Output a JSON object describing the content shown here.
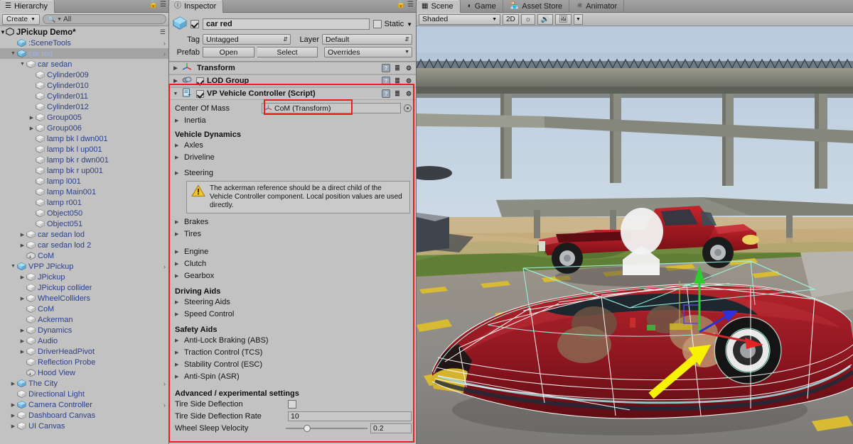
{
  "hierarchy": {
    "tab_label": "Hierarchy",
    "tab_icon": "hierarchy-icon",
    "create_label": "Create",
    "search_placeholder": "All",
    "search_value": "All",
    "scene_name": "JPickup Demo*",
    "items": [
      {
        "label": ":SceneTools",
        "depth": 1,
        "twisty": "",
        "icon": "prefab-cube",
        "chevron": true,
        "selected": false
      },
      {
        "label": "car red",
        "depth": 1,
        "twisty": "down",
        "icon": "prefab-cube",
        "chevron": true,
        "selected": true
      },
      {
        "label": "car sedan",
        "depth": 2,
        "twisty": "down",
        "icon": "gameobject-cube",
        "chevron": false,
        "selected": false
      },
      {
        "label": "Cylinder009",
        "depth": 3,
        "twisty": "",
        "icon": "gameobject-cube",
        "chevron": false,
        "selected": false
      },
      {
        "label": "Cylinder010",
        "depth": 3,
        "twisty": "",
        "icon": "gameobject-cube",
        "chevron": false,
        "selected": false
      },
      {
        "label": "Cylinder011",
        "depth": 3,
        "twisty": "",
        "icon": "gameobject-cube",
        "chevron": false,
        "selected": false
      },
      {
        "label": "Cylinder012",
        "depth": 3,
        "twisty": "",
        "icon": "gameobject-cube",
        "chevron": false,
        "selected": false
      },
      {
        "label": "Group005",
        "depth": 3,
        "twisty": "right",
        "icon": "gameobject-cube",
        "chevron": false,
        "selected": false
      },
      {
        "label": "Group006",
        "depth": 3,
        "twisty": "right",
        "icon": "gameobject-cube",
        "chevron": false,
        "selected": false
      },
      {
        "label": "lamp bk l dwn001",
        "depth": 3,
        "twisty": "",
        "icon": "gameobject-cube",
        "chevron": false,
        "selected": false
      },
      {
        "label": "lamp bk l up001",
        "depth": 3,
        "twisty": "",
        "icon": "gameobject-cube",
        "chevron": false,
        "selected": false
      },
      {
        "label": "lamp bk r dwn001",
        "depth": 3,
        "twisty": "",
        "icon": "gameobject-cube",
        "chevron": false,
        "selected": false
      },
      {
        "label": "lamp bk r up001",
        "depth": 3,
        "twisty": "",
        "icon": "gameobject-cube",
        "chevron": false,
        "selected": false
      },
      {
        "label": "lamp l001",
        "depth": 3,
        "twisty": "",
        "icon": "gameobject-cube",
        "chevron": false,
        "selected": false
      },
      {
        "label": "lamp Main001",
        "depth": 3,
        "twisty": "",
        "icon": "gameobject-cube",
        "chevron": false,
        "selected": false
      },
      {
        "label": "lamp r001",
        "depth": 3,
        "twisty": "",
        "icon": "gameobject-cube",
        "chevron": false,
        "selected": false
      },
      {
        "label": "Object050",
        "depth": 3,
        "twisty": "",
        "icon": "gameobject-cube",
        "chevron": false,
        "selected": false
      },
      {
        "label": "Object051",
        "depth": 3,
        "twisty": "",
        "icon": "gameobject-cube",
        "chevron": false,
        "selected": false
      },
      {
        "label": "car sedan lod",
        "depth": 2,
        "twisty": "right",
        "icon": "gameobject-cube",
        "chevron": false,
        "selected": false
      },
      {
        "label": "car sedan lod 2",
        "depth": 2,
        "twisty": "right",
        "icon": "gameobject-cube",
        "chevron": false,
        "selected": false
      },
      {
        "label": "CoM",
        "depth": 2,
        "twisty": "",
        "icon": "transform-cube",
        "chevron": false,
        "selected": false
      },
      {
        "label": "VPP JPickup",
        "depth": 1,
        "twisty": "down",
        "icon": "prefab-cube",
        "chevron": true,
        "selected": false
      },
      {
        "label": "JPickup",
        "depth": 2,
        "twisty": "right",
        "icon": "gameobject-cube",
        "chevron": false,
        "selected": false
      },
      {
        "label": "JPickup collider",
        "depth": 2,
        "twisty": "",
        "icon": "gameobject-cube",
        "chevron": false,
        "selected": false
      },
      {
        "label": "WheelColliders",
        "depth": 2,
        "twisty": "right",
        "icon": "gameobject-cube",
        "chevron": false,
        "selected": false
      },
      {
        "label": "CoM",
        "depth": 2,
        "twisty": "",
        "icon": "gameobject-cube",
        "chevron": false,
        "selected": false
      },
      {
        "label": "Ackerman",
        "depth": 2,
        "twisty": "",
        "icon": "gameobject-cube",
        "chevron": false,
        "selected": false
      },
      {
        "label": "Dynamics",
        "depth": 2,
        "twisty": "right",
        "icon": "gameobject-cube",
        "chevron": false,
        "selected": false
      },
      {
        "label": "Audio",
        "depth": 2,
        "twisty": "right",
        "icon": "gameobject-cube",
        "chevron": false,
        "selected": false
      },
      {
        "label": "DriverHeadPivot",
        "depth": 2,
        "twisty": "right",
        "icon": "gameobject-cube",
        "chevron": false,
        "selected": false
      },
      {
        "label": "Reflection Probe",
        "depth": 2,
        "twisty": "",
        "icon": "gameobject-cube",
        "chevron": false,
        "selected": false
      },
      {
        "label": "Hood View",
        "depth": 2,
        "twisty": "",
        "icon": "transform-cube",
        "chevron": false,
        "selected": false
      },
      {
        "label": "The City",
        "depth": 1,
        "twisty": "right",
        "icon": "prefab-cube",
        "chevron": true,
        "selected": false
      },
      {
        "label": "Directional Light",
        "depth": 1,
        "twisty": "",
        "icon": "gameobject-cube",
        "chevron": false,
        "selected": false
      },
      {
        "label": "Camera Controller",
        "depth": 1,
        "twisty": "right",
        "icon": "prefab-cube",
        "chevron": true,
        "selected": false
      },
      {
        "label": "Dashboard Canvas",
        "depth": 1,
        "twisty": "right",
        "icon": "gameobject-cube",
        "chevron": false,
        "selected": false
      },
      {
        "label": "UI Canvas",
        "depth": 1,
        "twisty": "right",
        "icon": "gameobject-cube",
        "chevron": false,
        "selected": false
      }
    ]
  },
  "inspector": {
    "tab_label": "Inspector",
    "object_name": "car red",
    "enabled": true,
    "static_label": "Static",
    "static_checked": false,
    "tag_label": "Tag",
    "tag_value": "Untagged",
    "layer_label": "Layer",
    "layer_value": "Default",
    "prefab_label": "Prefab",
    "prefab_open": "Open",
    "prefab_select": "Select",
    "prefab_overrides": "Overrides",
    "components": [
      {
        "name": "Transform",
        "has_checkbox": false,
        "icon": "transform-icon"
      },
      {
        "name": "LOD Group",
        "has_checkbox": true,
        "checked": true,
        "icon": "lodgroup-icon"
      },
      {
        "name": "VP Vehicle Controller (Script)",
        "has_checkbox": true,
        "checked": true,
        "icon": "script-icon"
      }
    ],
    "vehicle_controller": {
      "center_of_mass_label": "Center Of Mass",
      "center_of_mass_value": "CoM (Transform)",
      "inertia_label": "Inertia",
      "section_vehicle_dynamics": "Vehicle Dynamics",
      "axles_label": "Axles",
      "driveline_label": "Driveline",
      "steering_label": "Steering",
      "warning_text": "The ackerman reference should be a direct child of the Vehicle Controller component. Local position values are used directly.",
      "brakes_label": "Brakes",
      "tires_label": "Tires",
      "engine_label": "Engine",
      "clutch_label": "Clutch",
      "gearbox_label": "Gearbox",
      "section_driving_aids": "Driving Aids",
      "steering_aids_label": "Steering Aids",
      "speed_control_label": "Speed Control",
      "section_safety_aids": "Safety Aids",
      "abs_label": "Anti-Lock Braking (ABS)",
      "tcs_label": "Traction Control (TCS)",
      "esc_label": "Stability Control (ESC)",
      "asr_label": "Anti-Spin (ASR)",
      "section_advanced": "Advanced / experimental settings",
      "tire_side_deflection_label": "Tire Side Deflection",
      "tire_side_deflection_checked": false,
      "tire_side_deflection_rate_label": "Tire Side Deflection Rate",
      "tire_side_deflection_rate_value": "10",
      "wheel_sleep_velocity_label": "Wheel Sleep Velocity",
      "wheel_sleep_velocity_value": "0.2"
    }
  },
  "scene": {
    "tabs": [
      {
        "label": "Scene",
        "icon": "scene-grid-icon",
        "active": true
      },
      {
        "label": "Game",
        "icon": "game-icon",
        "active": false
      },
      {
        "label": "Asset Store",
        "icon": "store-icon",
        "active": false
      },
      {
        "label": "Animator",
        "icon": "animator-icon",
        "active": false
      }
    ],
    "toolbar": {
      "draw_mode": "Shaded",
      "two_d": "2D",
      "lighting_icon": "sun-icon",
      "audio_icon": "speaker-icon",
      "effects_icon": "image-icon",
      "effects_arrow": "chevron-down-icon"
    }
  },
  "annotations": {
    "accent_red": "#ee1c1c",
    "accent_yellow": "#f6f000",
    "arrow_name": "yellow-pointer-arrow"
  }
}
